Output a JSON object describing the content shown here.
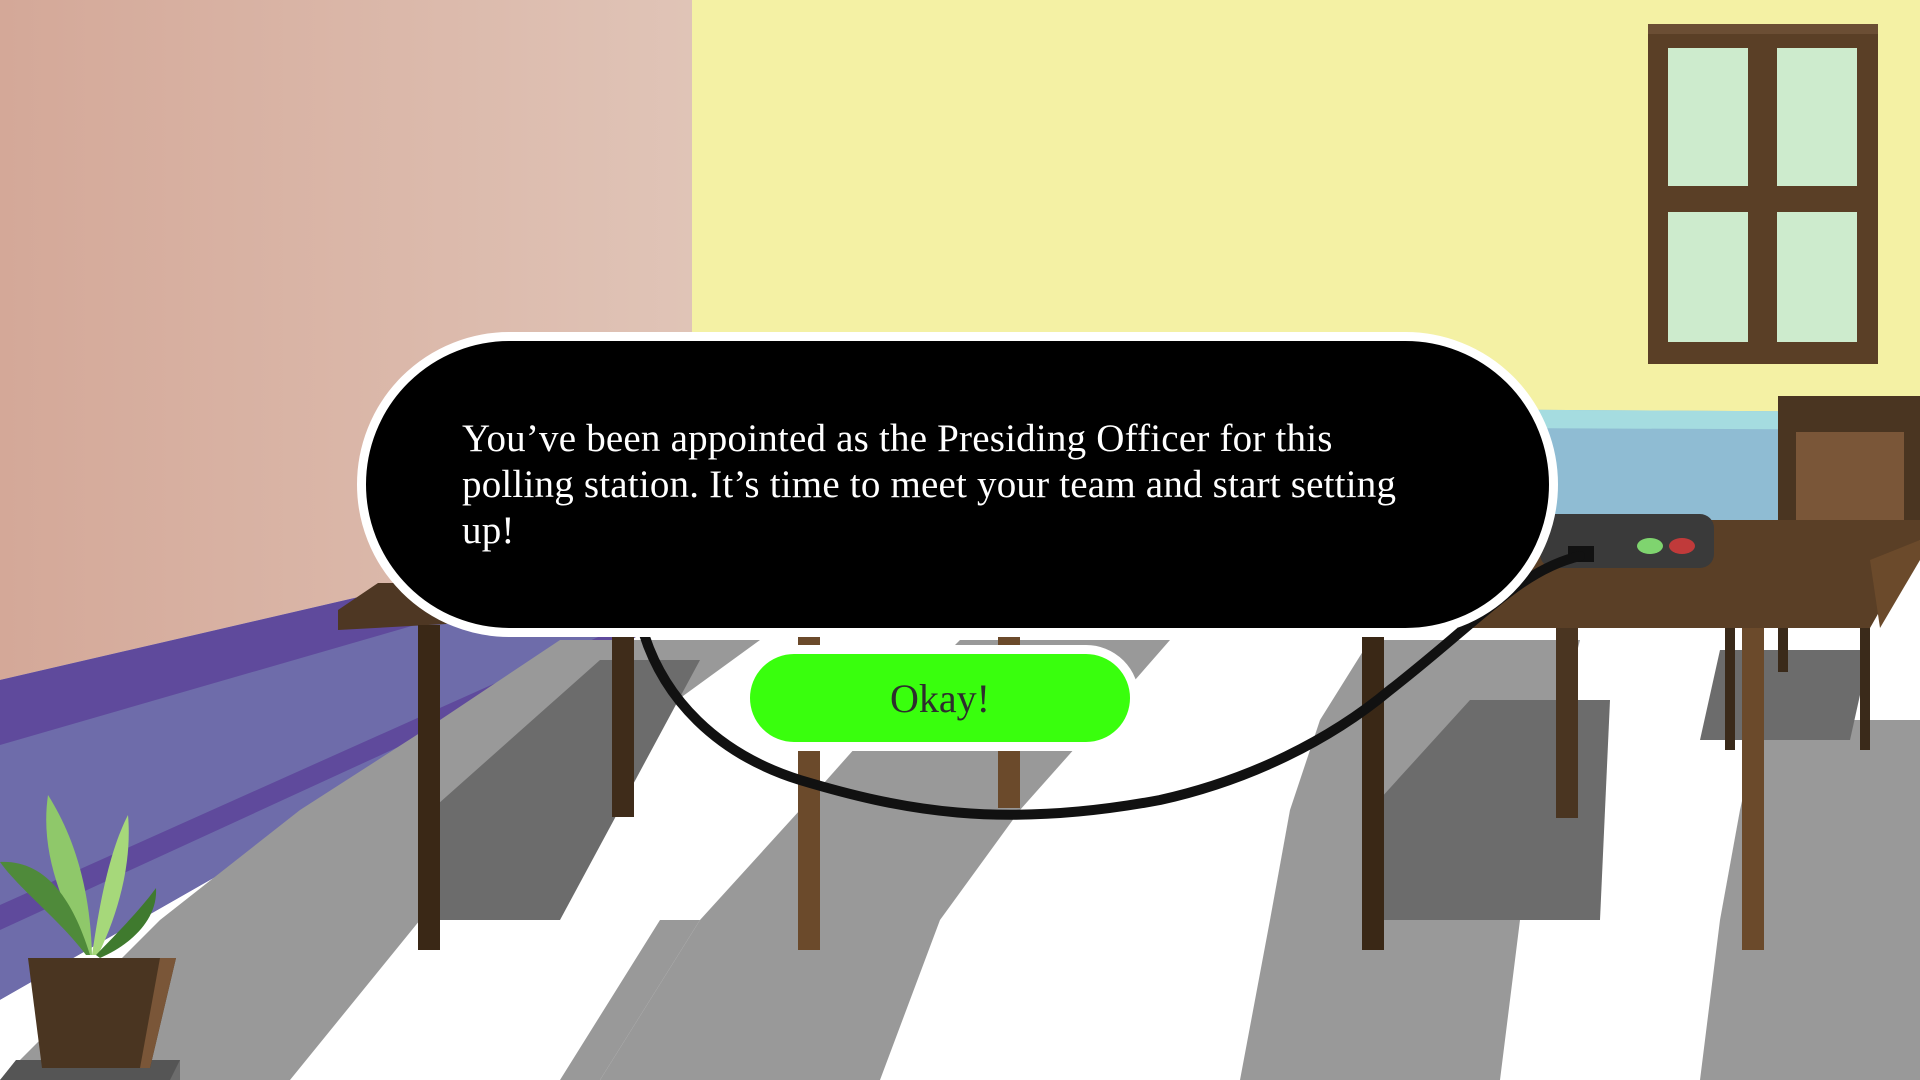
{
  "dialog": {
    "message": "You’ve been appointed as the Presiding Officer for this polling station. It’s time to meet your team and start setting up!"
  },
  "okay_button": {
    "label": "Okay!"
  },
  "colors": {
    "left_wall": "#d9b5a5",
    "back_wall": "#f4f1a4",
    "baseboard": "#6e6caa",
    "floor_dark": "#999999",
    "floor_light": "#ffffff",
    "table_wood": "#5a3f26",
    "dialog_background": "#000000",
    "button_green": "#39ff0d",
    "window_glass": "#cdebcd",
    "plant_leaf": "#5e9b47"
  },
  "icons": {
    "plant": "potted-plant-icon",
    "window": "window-icon",
    "power_strip": "power-strip-icon"
  }
}
